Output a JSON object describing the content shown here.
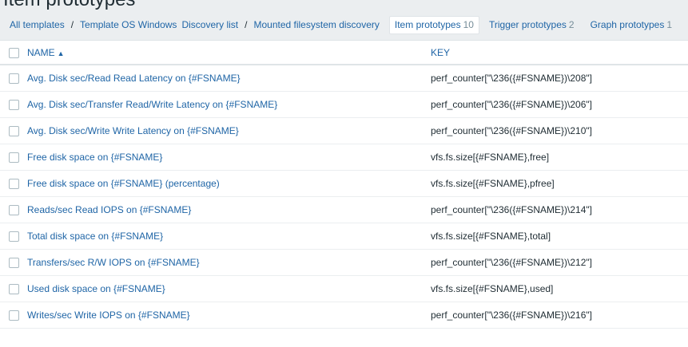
{
  "page": {
    "title": "Item prototypes"
  },
  "breadcrumbs": {
    "all_templates": "All templates",
    "separator": "/",
    "template": "Template OS Windows",
    "discovery_list": "Discovery list",
    "discovery_rule": "Mounted filesystem discovery"
  },
  "tabs": {
    "item_prototypes": {
      "label": "Item prototypes",
      "count": "10"
    },
    "trigger_prototypes": {
      "label": "Trigger prototypes",
      "count": "2"
    },
    "graph_prototypes": {
      "label": "Graph prototypes",
      "count": "1"
    }
  },
  "table": {
    "headers": {
      "name": "NAME",
      "key": "KEY"
    },
    "sort_icon": "sort-ascending-icon",
    "rows": [
      {
        "name": "Avg. Disk sec/Read Read Latency on {#FSNAME}",
        "key": "perf_counter[\"\\236({#FSNAME})\\208\"]"
      },
      {
        "name": "Avg. Disk sec/Transfer Read/Write Latency on {#FSNAME}",
        "key": "perf_counter[\"\\236({#FSNAME})\\206\"]"
      },
      {
        "name": "Avg. Disk sec/Write Write Latency on {#FSNAME}",
        "key": "perf_counter[\"\\236({#FSNAME})\\210\"]"
      },
      {
        "name": "Free disk space on {#FSNAME}",
        "key": "vfs.fs.size[{#FSNAME},free]"
      },
      {
        "name": "Free disk space on {#FSNAME} (percentage)",
        "key": "vfs.fs.size[{#FSNAME},pfree]"
      },
      {
        "name": "Reads/sec Read IOPS on {#FSNAME}",
        "key": "perf_counter[\"\\236({#FSNAME})\\214\"]"
      },
      {
        "name": "Total disk space on {#FSNAME}",
        "key": "vfs.fs.size[{#FSNAME},total]"
      },
      {
        "name": "Transfers/sec R/W IOPS on {#FSNAME}",
        "key": "perf_counter[\"\\236({#FSNAME})\\212\"]"
      },
      {
        "name": "Used disk space on {#FSNAME}",
        "key": "vfs.fs.size[{#FSNAME},used]"
      },
      {
        "name": "Writes/sec Write IOPS on {#FSNAME}",
        "key": "perf_counter[\"\\236({#FSNAME})\\216\"]"
      }
    ]
  },
  "colors": {
    "link": "#1f65a6",
    "text": "#1f2c33",
    "muted": "#768d99",
    "background": "#ebeef0"
  }
}
